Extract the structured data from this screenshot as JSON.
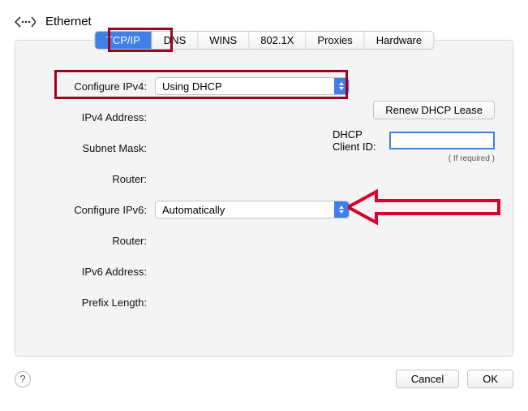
{
  "header": {
    "title": "Ethernet"
  },
  "tabs": [
    "TCP/IP",
    "DNS",
    "WINS",
    "802.1X",
    "Proxies",
    "Hardware"
  ],
  "selected_tab": 0,
  "ipv4": {
    "configure_label": "Configure IPv4:",
    "configure_value": "Using DHCP",
    "address_label": "IPv4 Address:",
    "subnet_label": "Subnet Mask:",
    "router_label": "Router:",
    "renew_label": "Renew DHCP Lease",
    "dhcp_client_id_label": "DHCP Client ID:",
    "dhcp_client_id_value": "",
    "if_required": "( If required )"
  },
  "ipv6": {
    "configure_label": "Configure IPv6:",
    "configure_value": "Automatically",
    "router_label": "Router:",
    "address_label": "IPv6 Address:",
    "prefix_label": "Prefix Length:"
  },
  "buttons": {
    "cancel": "Cancel",
    "ok": "OK"
  },
  "annotations": {
    "highlight_color": "#a2001e",
    "arrow_color": "#d8002a"
  }
}
